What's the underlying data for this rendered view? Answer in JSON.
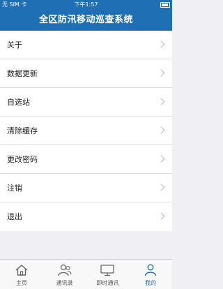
{
  "status_bar": {
    "carrier": "无 SIM 卡",
    "time": "下午1:57"
  },
  "header": {
    "title": "全区防汛移动巡查系统"
  },
  "menu": {
    "items": [
      {
        "label": "关于"
      },
      {
        "label": "数据更新"
      },
      {
        "label": "自选站"
      },
      {
        "label": "清除缓存"
      },
      {
        "label": "更改密码"
      },
      {
        "label": "注销"
      },
      {
        "label": "退出"
      }
    ]
  },
  "tab_bar": {
    "tabs": [
      {
        "label": "主页",
        "icon": "home-icon"
      },
      {
        "label": "通讯录",
        "icon": "contacts-icon"
      },
      {
        "label": "即时通讯",
        "icon": "monitor-icon"
      },
      {
        "label": "我的",
        "icon": "user-icon"
      }
    ],
    "active_index": 3
  },
  "colors": {
    "brand": "#1f6fb5",
    "background": "#efeff4"
  }
}
